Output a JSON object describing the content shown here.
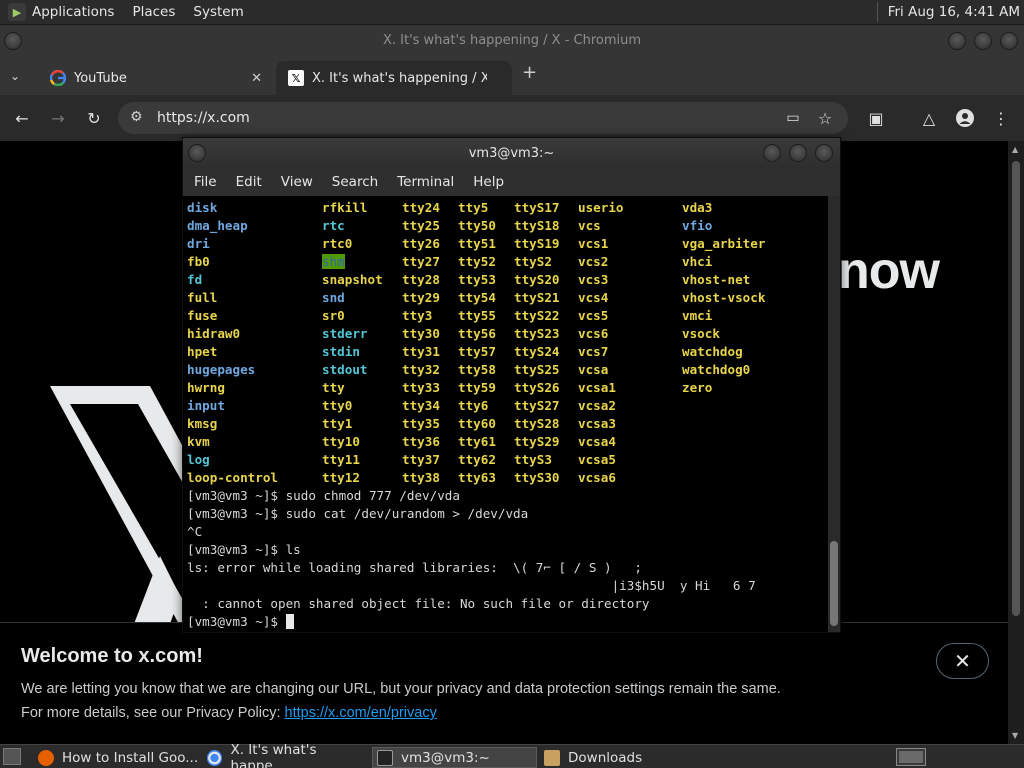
{
  "top_panel": {
    "menus": [
      "Applications",
      "Places",
      "System"
    ],
    "clock": "Fri Aug 16,  4:41 AM"
  },
  "browser": {
    "window_title": "X. It's what's happening / X - Chromium",
    "tabs": [
      {
        "label": "YouTube",
        "favicon": "google-g-icon"
      },
      {
        "label": "X. It's what's happening / X",
        "favicon": "x-logo-icon"
      }
    ],
    "url": "https://x.com"
  },
  "page": {
    "hero_text": "now",
    "welcome": {
      "title": "Welcome to x.com!",
      "line1": "We are letting you know that we are changing our URL, but your privacy and data protection settings remain the same.",
      "line2_prefix": "For more details, see our Privacy Policy: ",
      "link": "https://x.com/en/privacy"
    }
  },
  "terminal": {
    "title": "vm3@vm3:~",
    "menus": [
      "File",
      "Edit",
      "View",
      "Search",
      "Terminal",
      "Help"
    ],
    "ls_columns": [
      [
        "disk",
        "dma_heap",
        "dri",
        "fb0",
        "fd",
        "full",
        "fuse",
        "hidraw0",
        "hpet",
        "hugepages",
        "hwrng",
        "input",
        "kmsg",
        "kvm",
        "log",
        "loop-control"
      ],
      [
        "rfkill",
        "rtc",
        "rtc0",
        "shm",
        "snapshot",
        "snd",
        "sr0",
        "stderr",
        "stdin",
        "stdout",
        "tty",
        "tty0",
        "tty1",
        "tty10",
        "tty11",
        "tty12"
      ],
      [
        "tty24",
        "tty25",
        "tty26",
        "tty27",
        "tty28",
        "tty29",
        "tty3",
        "tty30",
        "tty31",
        "tty32",
        "tty33",
        "tty34",
        "tty35",
        "tty36",
        "tty37",
        "tty38"
      ],
      [
        "tty5",
        "tty50",
        "tty51",
        "tty52",
        "tty53",
        "tty54",
        "tty55",
        "tty56",
        "tty57",
        "tty58",
        "tty59",
        "tty6",
        "tty60",
        "tty61",
        "tty62",
        "tty63"
      ],
      [
        "ttyS17",
        "ttyS18",
        "ttyS19",
        "ttyS2",
        "ttyS20",
        "ttyS21",
        "ttyS22",
        "ttyS23",
        "ttyS24",
        "ttyS25",
        "ttyS26",
        "ttyS27",
        "ttyS28",
        "ttyS29",
        "ttyS3",
        "ttyS30"
      ],
      [
        "userio",
        "vcs",
        "vcs1",
        "vcs2",
        "vcs3",
        "vcs4",
        "vcs5",
        "vcs6",
        "vcs7",
        "vcsa",
        "vcsa1",
        "vcsa2",
        "vcsa3",
        "vcsa4",
        "vcsa5",
        "vcsa6"
      ],
      [
        "vda3",
        "vfio",
        "vga_arbiter",
        "vhci",
        "vhost-net",
        "vhost-vsock",
        "vmci",
        "vsock",
        "watchdog",
        "watchdog0",
        "zero"
      ]
    ],
    "ls_colors": [
      [
        "dir",
        "dir",
        "dir",
        "char",
        "link",
        "char",
        "char",
        "char",
        "char",
        "dir",
        "char",
        "dir",
        "char",
        "char",
        "link",
        "char"
      ],
      [
        "char",
        "link",
        "char",
        "hl",
        "char",
        "dir",
        "char",
        "link",
        "link",
        "link",
        "char",
        "char",
        "char",
        "char",
        "char",
        "char"
      ],
      [
        "char",
        "char",
        "char",
        "char",
        "char",
        "char",
        "char",
        "char",
        "char",
        "char",
        "char",
        "char",
        "char",
        "char",
        "char",
        "char"
      ],
      [
        "char",
        "char",
        "char",
        "char",
        "char",
        "char",
        "char",
        "char",
        "char",
        "char",
        "char",
        "char",
        "char",
        "char",
        "char",
        "char"
      ],
      [
        "char",
        "char",
        "char",
        "char",
        "char",
        "char",
        "char",
        "char",
        "char",
        "char",
        "char",
        "char",
        "char",
        "char",
        "char",
        "char"
      ],
      [
        "char",
        "char",
        "char",
        "char",
        "char",
        "char",
        "char",
        "char",
        "char",
        "char",
        "char",
        "char",
        "char",
        "char",
        "char",
        "char"
      ],
      [
        "char",
        "dir",
        "char",
        "char",
        "char",
        "char",
        "char",
        "char",
        "char",
        "char",
        "char"
      ]
    ],
    "lines": [
      "[vm3@vm3 ~]$ sudo chmod 777 /dev/vda",
      "[vm3@vm3 ~]$ sudo cat /dev/urandom > /dev/vda",
      "^C",
      "[vm3@vm3 ~]$ ls",
      "ls: error while loading shared libraries:  \\( 7⌐ [ / S )   ;",
      "                                                        |i3$h5U  y Hi   6 7",
      "  : cannot open shared object file: No such file or directory",
      "[vm3@vm3 ~]$ "
    ]
  },
  "taskbar": {
    "tasks": [
      {
        "label": "How to Install Goo...",
        "icon": "firefox-icon"
      },
      {
        "label": "X. It's what's happe...",
        "icon": "chromium-icon"
      },
      {
        "label": "vm3@vm3:~",
        "icon": "terminal-icon"
      },
      {
        "label": "Downloads",
        "icon": "folder-icon"
      }
    ]
  }
}
